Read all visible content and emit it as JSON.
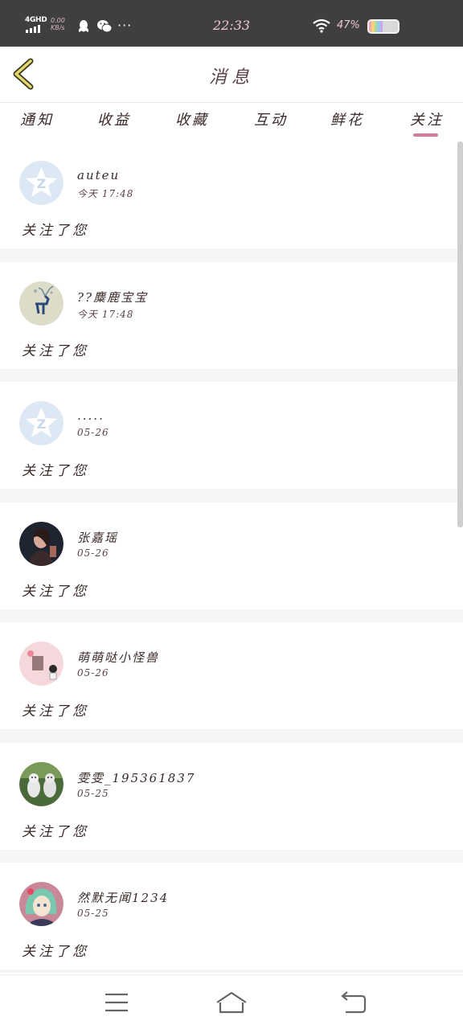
{
  "status_bar": {
    "network": "4GHD",
    "speed_value": "0.00",
    "speed_unit": "KB/s",
    "more": "···",
    "time": "22:33",
    "battery_percent": "47%",
    "battery_level": 0.47
  },
  "header": {
    "title": "消息"
  },
  "tabs": [
    {
      "label": "通知"
    },
    {
      "label": "收益"
    },
    {
      "label": "收藏"
    },
    {
      "label": "互动"
    },
    {
      "label": "鲜花"
    },
    {
      "label": "关注",
      "active": true
    }
  ],
  "notifications": [
    {
      "name": "auteu",
      "time": "今天 17:48",
      "message": "关注了您",
      "avatar": "default-qq-avatar"
    },
    {
      "name": "??麋鹿宝宝",
      "time": "今天 17:48",
      "message": "关注了您",
      "avatar": "deer-avatar"
    },
    {
      "name": ".....",
      "time": "05-26",
      "message": "关注了您",
      "avatar": "default-qq-avatar"
    },
    {
      "name": "张嘉瑶",
      "time": "05-26",
      "message": "关注了您",
      "avatar": "girl-avatar"
    },
    {
      "name": "萌萌哒小怪兽",
      "time": "05-26",
      "message": "关注了您",
      "avatar": "cartoon-avatar"
    },
    {
      "name": "雯雯_195361837",
      "time": "05-25",
      "message": "关注了您",
      "avatar": "cats-avatar"
    },
    {
      "name": "然默无闻1234",
      "time": "05-25",
      "message": "关注了您",
      "avatar": "anime-avatar"
    }
  ],
  "colors": {
    "accent": "#d17b9d",
    "status_bar_bg": "#3f3f3f",
    "list_bg": "#f6f6f6"
  }
}
